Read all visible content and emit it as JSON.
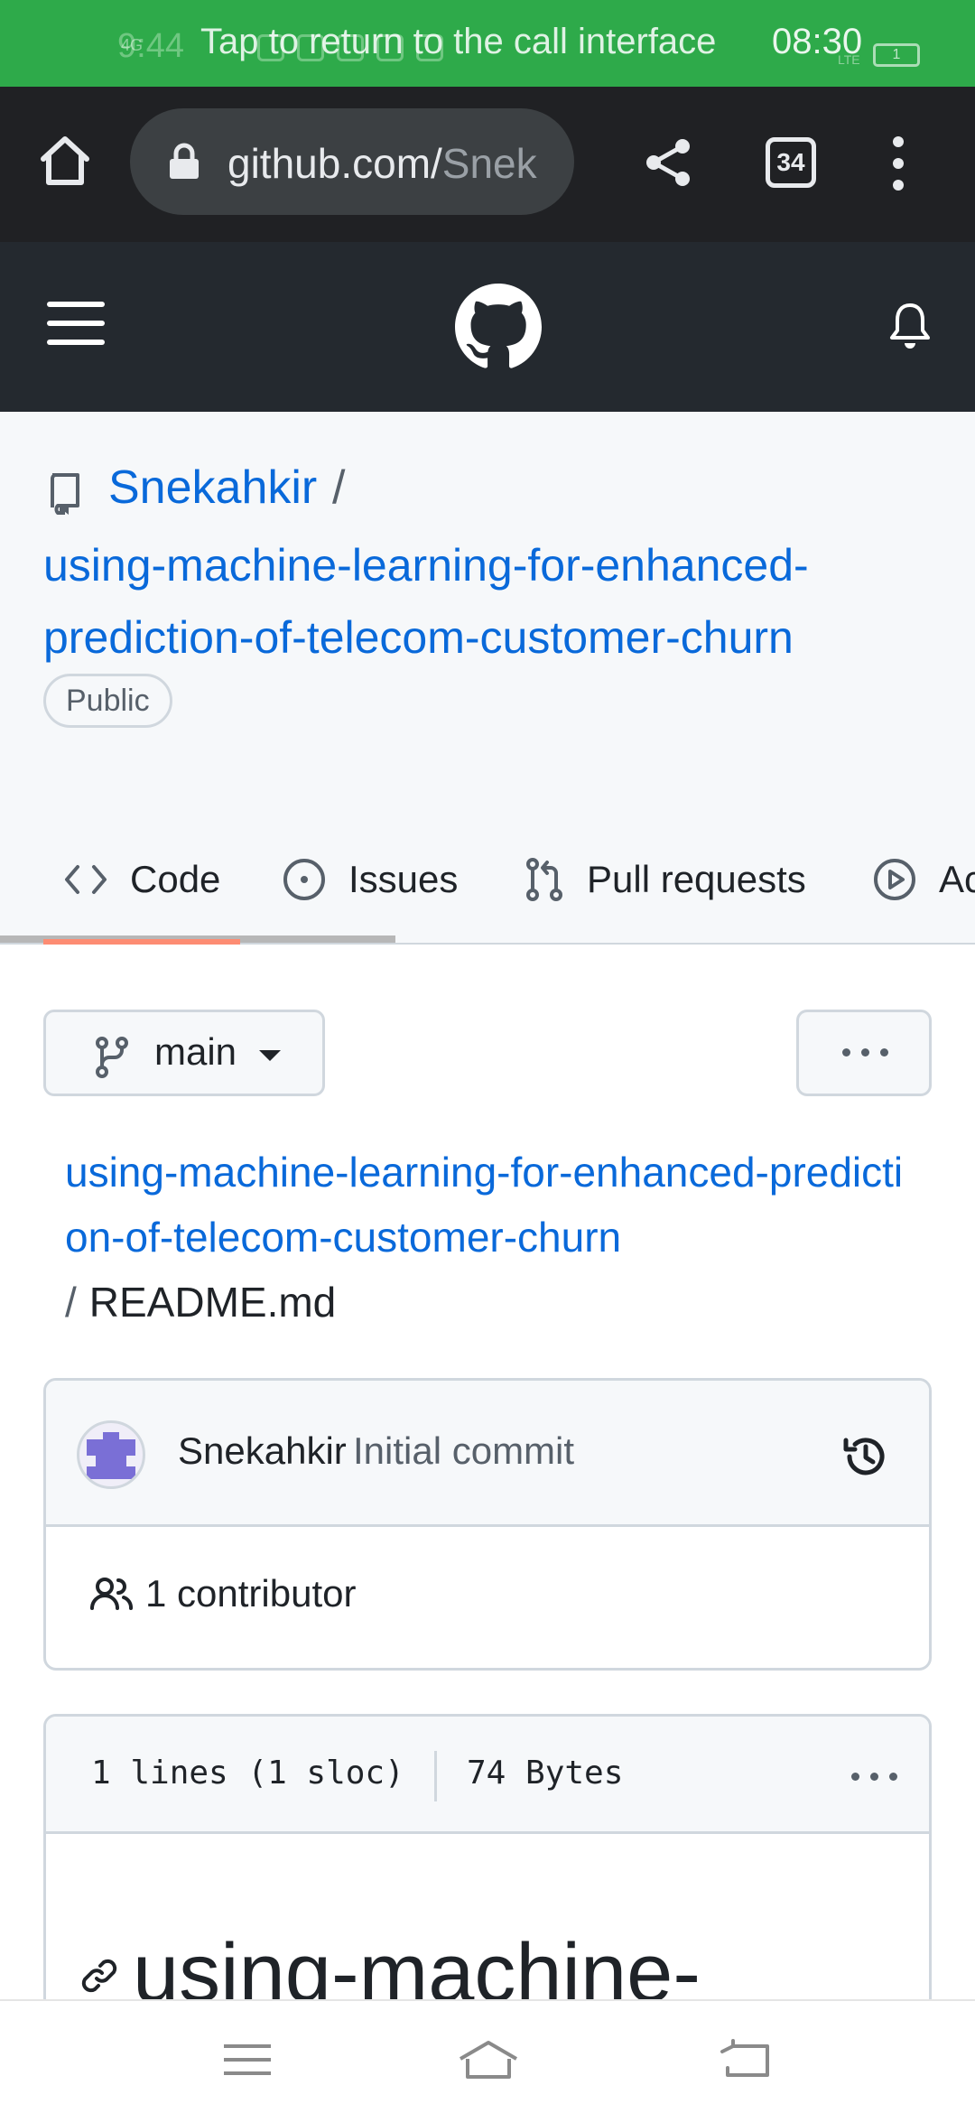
{
  "status_bar": {
    "call_message": "Tap to return to the call interface",
    "time": "08:30",
    "ghost_time": "9:44",
    "network": "4G",
    "lte": "LTE",
    "battery": "1"
  },
  "browser": {
    "url_host": "github.com/",
    "url_path": "Snek",
    "tab_count": "34",
    "icons": [
      "home-icon",
      "lock-icon",
      "share-icon",
      "tabs-icon",
      "more-vert-icon"
    ]
  },
  "github_header": {
    "icons": [
      "hamburger-menu-icon",
      "github-logo-icon",
      "bell-icon"
    ]
  },
  "repo": {
    "owner": "Snekahkir",
    "separator": "/",
    "name": "using-machine-learning-for-enhanced-prediction-of-telecom-customer-churn",
    "visibility": "Public"
  },
  "tabs": [
    {
      "label": "Code",
      "icon": "code-icon"
    },
    {
      "label": "Issues",
      "icon": "issue-opened-icon"
    },
    {
      "label": "Pull requests",
      "icon": "git-pull-request-icon"
    },
    {
      "label": "Ac",
      "icon": "play-icon"
    }
  ],
  "branch": {
    "label": "main"
  },
  "breadcrumb": {
    "repo_link": "using-machine-learning-for-enhanced-prediction-of-telecom-customer-churn",
    "separator": "/",
    "file": "README.md"
  },
  "commit": {
    "author": "Snekahkir",
    "message": "Initial commit",
    "contributors": "1 contributor"
  },
  "file": {
    "lines": "1 lines (1 sloc)",
    "size": "74 Bytes",
    "heading": "using-machine-"
  },
  "colors": {
    "call_banner": "#2eaa4a",
    "browser_bar": "#202124",
    "github_header": "#24292f",
    "link": "#0969da",
    "active_tab_underline": "#fd8c73"
  }
}
